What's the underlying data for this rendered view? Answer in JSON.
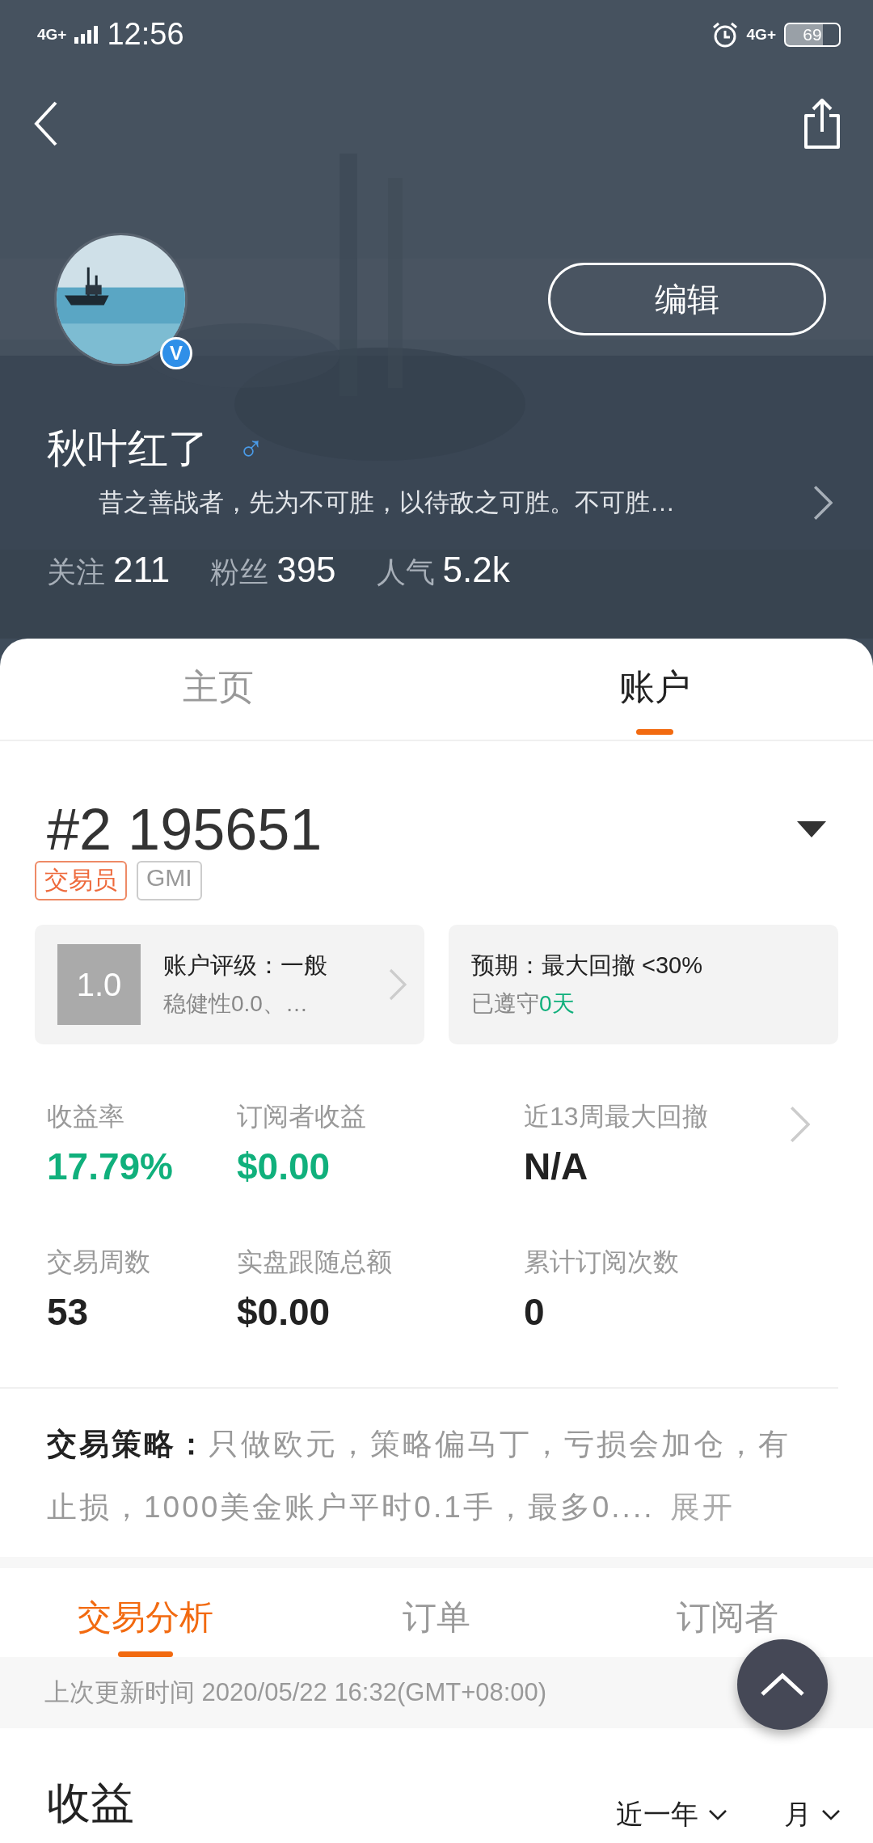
{
  "status_bar": {
    "signal_label": "4G+",
    "time": "12:56",
    "network_label": "4G+",
    "battery": "69"
  },
  "profile": {
    "name": "秋叶红了",
    "gender": "♂",
    "verified": true,
    "verified_badge": "V",
    "edit_button": "编辑",
    "motto": "昔之善战者，先为不可胜，以待敌之可胜。不可胜…",
    "stats": [
      {
        "label": "关注",
        "value": "211"
      },
      {
        "label": "粉丝",
        "value": "395"
      },
      {
        "label": "人气",
        "value": "5.2k"
      }
    ]
  },
  "tabs": [
    {
      "label": "主页",
      "selected": false
    },
    {
      "label": "账户",
      "selected": true
    }
  ],
  "account": {
    "number": "#2 195651",
    "tags": [
      {
        "label": "交易员",
        "kind": "accent"
      },
      {
        "label": "GMI",
        "kind": "plain"
      }
    ],
    "rating_card": {
      "score": "1.0",
      "title": "账户评级：一般",
      "detail": "稳健性0.0、…"
    },
    "expectation_card": {
      "title": "预期：最大回撤 <30%",
      "detail": "已遵守",
      "detail_value": "0天"
    }
  },
  "metrics": [
    {
      "label": "收益率",
      "value": "17.79%",
      "positive": true
    },
    {
      "label": "订阅者收益",
      "value": "$0.00",
      "positive": true
    },
    {
      "label": "近13周最大回撤",
      "value": "N/A",
      "positive": false
    },
    {
      "label": "交易周数",
      "value": "53",
      "positive": false
    },
    {
      "label": "实盘跟随总额",
      "value": "$0.00",
      "positive": false
    },
    {
      "label": "累计订阅次数",
      "value": "0",
      "positive": false
    }
  ],
  "strategy": {
    "text": "**交易策略：**只做欧元，策略偏马丁，亏损会加仓，有止损，1000美金账户平时0.1手，最多0....",
    "expand": "展开"
  },
  "sub_tabs": [
    {
      "label": "交易分析",
      "selected": true
    },
    {
      "label": "订单",
      "selected": false
    },
    {
      "label": "订阅者",
      "selected": false
    }
  ],
  "update_text": "上次更新时间 2020/05/22 16:32(GMT+08:00)",
  "section": {
    "title": "收益",
    "filters": [
      "近一年",
      "月"
    ]
  }
}
